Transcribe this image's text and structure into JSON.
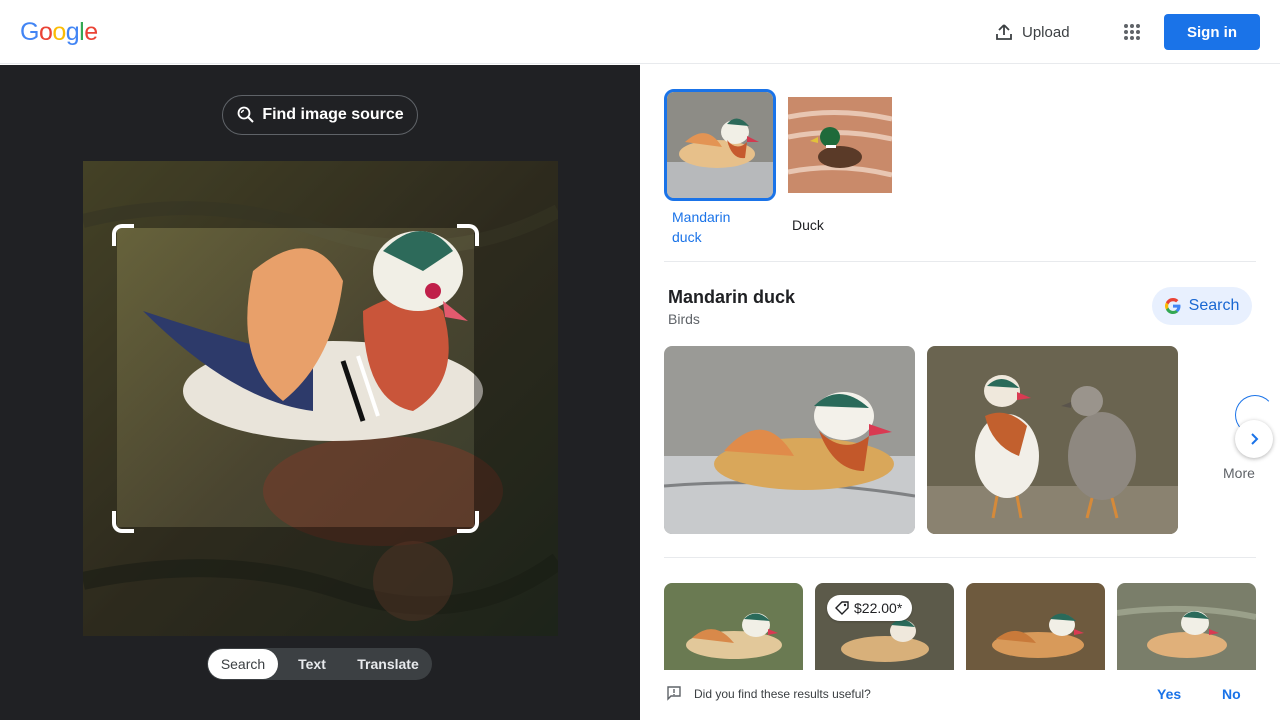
{
  "header": {
    "logo_letters": [
      {
        "ch": "G",
        "color": "#4285F4"
      },
      {
        "ch": "o",
        "color": "#EA4335"
      },
      {
        "ch": "o",
        "color": "#FBBC05"
      },
      {
        "ch": "g",
        "color": "#4285F4"
      },
      {
        "ch": "l",
        "color": "#34A853"
      },
      {
        "ch": "e",
        "color": "#EA4335"
      }
    ],
    "upload_label": "Upload",
    "upload_icon": "upload-icon",
    "apps_icon": "apps-grid-icon",
    "signin_label": "Sign in"
  },
  "left_pane": {
    "find_source_label": "Find image source",
    "find_source_icon": "lens-search-icon",
    "modes": [
      {
        "label": "Search",
        "active": true
      },
      {
        "label": "Text",
        "active": false
      },
      {
        "label": "Translate",
        "active": false
      }
    ]
  },
  "right_pane": {
    "thumbs": [
      {
        "label": "Mandarin duck",
        "active": true
      },
      {
        "label": "Duck",
        "active": false
      }
    ],
    "knowledge": {
      "title": "Mandarin duck",
      "subtitle": "Birds",
      "search_label": "Search"
    },
    "more_label": "More",
    "price": "$22.00*",
    "feedback": {
      "question": "Did you find these results useful?",
      "yes": "Yes",
      "no": "No"
    }
  },
  "colors": {
    "accent": "#1a73e8",
    "dark_pane": "#202124"
  }
}
